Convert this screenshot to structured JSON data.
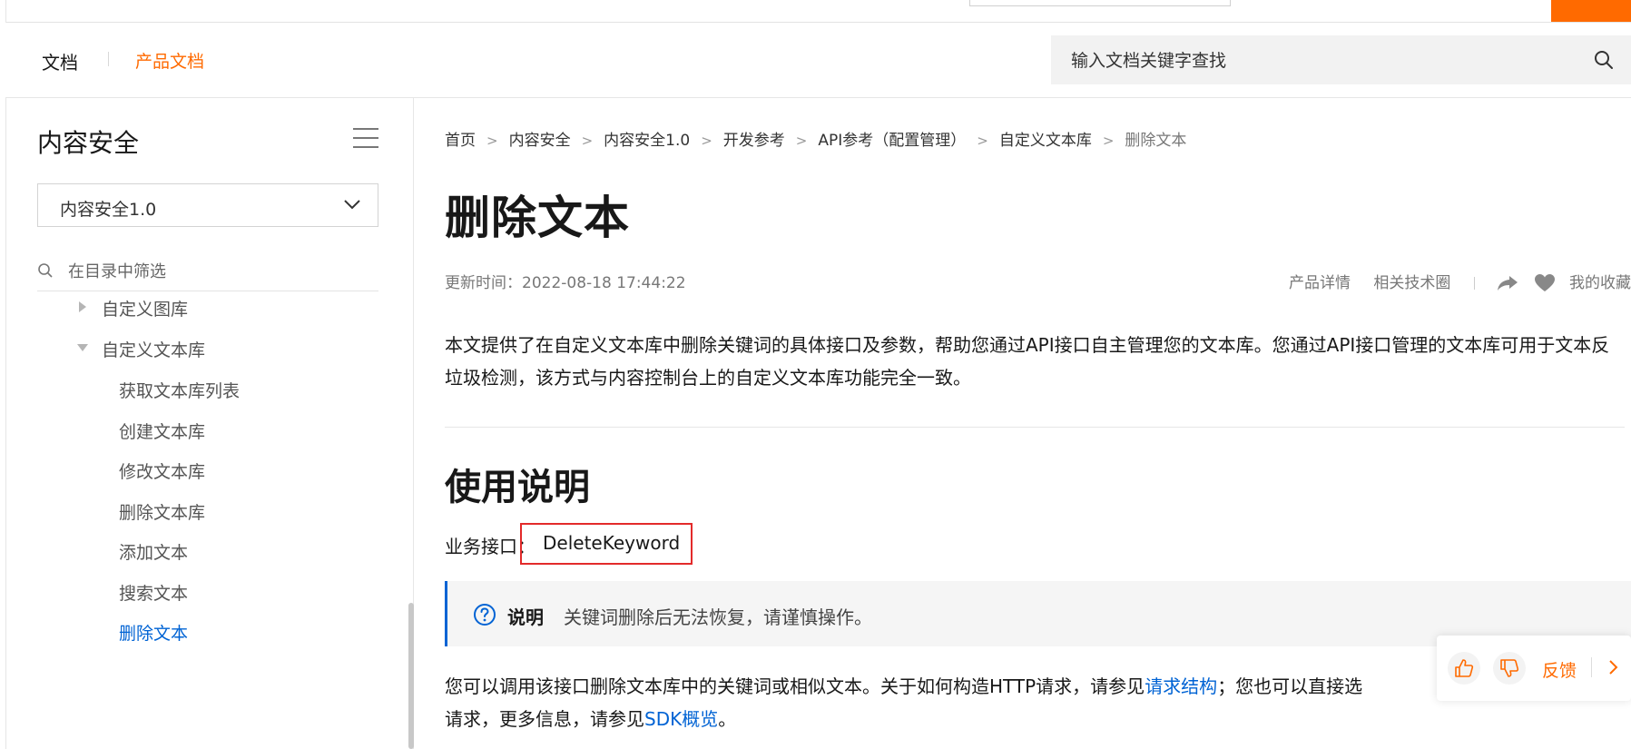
{
  "header": {
    "docs_label": "文档",
    "product_docs_label": "产品文档",
    "search_placeholder": "输入文档关键字查找",
    "accent_color": "#ff6a00"
  },
  "sidebar": {
    "title": "内容安全",
    "version_select": "内容安全1.0",
    "filter_placeholder": "在目录中筛选",
    "tree": [
      {
        "label": "自定义图库",
        "expanded": false
      },
      {
        "label": "自定义文本库",
        "expanded": true
      },
      {
        "label": "获取文本库列表"
      },
      {
        "label": "创建文本库"
      },
      {
        "label": "修改文本库"
      },
      {
        "label": "删除文本库"
      },
      {
        "label": "添加文本"
      },
      {
        "label": "搜索文本"
      },
      {
        "label": "删除文本",
        "active": true
      }
    ]
  },
  "main": {
    "breadcrumb": [
      "首页",
      "内容安全",
      "内容安全1.0",
      "开发参考",
      "API参考（配置管理）",
      "自定义文本库",
      "删除文本"
    ],
    "title": "删除文本",
    "updated": "更新时间：2022-08-18 17:44:22",
    "links": [
      "产品详情",
      "相关技术圈"
    ],
    "favorite": "我的收藏",
    "intro": "本文提供了在自定义文本库中删除关键词的具体接口及参数，帮助您通过API接口自主管理您的文本库。您通过API接口管理的文本库可用于文本反垃圾检测，该方式与内容控制台上的自定义文本库功能完全一致。",
    "section_title": "使用说明",
    "api_label": "业务接口：",
    "api_name": "DeleteKeyword",
    "note_label": "说明",
    "note_text": "关键词删除后无法恢复，请谨慎操作。",
    "para_part1": "您可以调用该接口删除文本库中的关键词或相似文本。关于如何构造HTTP请求，请参见",
    "para_link1": "请求结构",
    "para_part2": "；您也可以直接选",
    "para_part3": "请求，更多信息，请参见",
    "para_link2": "SDK概览",
    "para_part4": "。",
    "link_color": "#0063d4"
  },
  "feedback": {
    "label": "反馈"
  }
}
